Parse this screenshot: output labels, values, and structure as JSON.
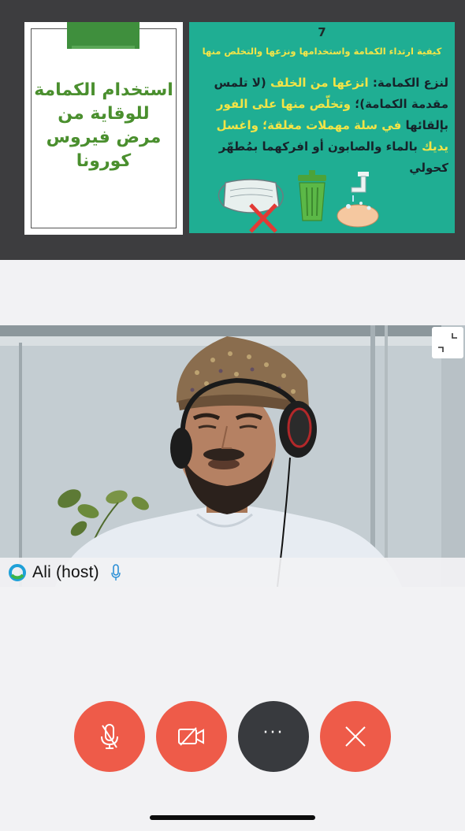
{
  "shared_content": {
    "slide_left": {
      "title": "استخدام الكمامة للوقاية من مرض فيروس كورونا"
    },
    "slide_right": {
      "number": "7",
      "subtitle": "كيفية ارتداء الكمامة واستخدامها ونزعها والتخلص منها",
      "body_1": "لنزع الكمامة: ",
      "body_2": "انزعها من الخلف",
      "body_3": " (لا تلمس مقدمة الكمامة)؛ ",
      "body_4": "وتخلّص منها على الفور",
      "body_5": " بإلقائها ",
      "body_6": "في سلة مهملات مغلقة؛ واغسل يديك",
      "body_7": " بالماء والصابون أو افركهما بمُطهّر كحولي"
    },
    "colors": {
      "slide_green_bg": "#1fae93",
      "highlight_yellow": "#f2e447",
      "title_green": "#4a8f2e"
    }
  },
  "participant": {
    "name": "Ali (host)",
    "status_icon": "connection-status-icon",
    "mic_icon": "microphone-icon"
  },
  "controls": {
    "mute": {
      "icon": "microphone-muted-icon"
    },
    "video": {
      "icon": "camera-off-icon"
    },
    "more": {
      "label": "···",
      "icon": "more-icon"
    },
    "leave": {
      "icon": "close-icon"
    },
    "colors": {
      "red": "#ee5b49",
      "dark": "#383a3e"
    }
  }
}
